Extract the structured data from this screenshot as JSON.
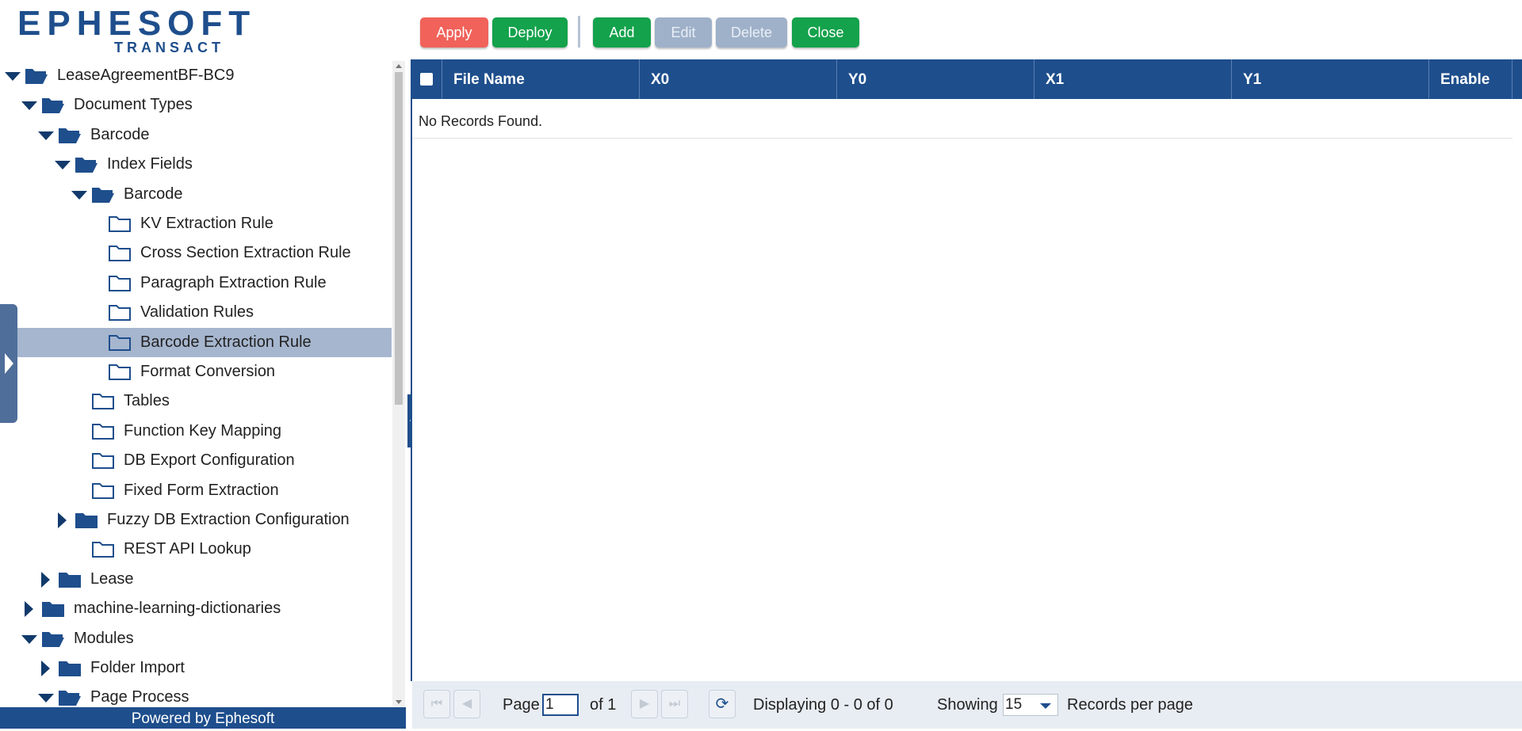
{
  "logo": {
    "word": "EPHESOFT",
    "sub": "TRANSACT"
  },
  "tree": [
    {
      "label": "LeaseAgreementBF-BC9",
      "expander": "down",
      "folder": "open"
    },
    {
      "label": "Document Types",
      "expander": "down",
      "folder": "open"
    },
    {
      "label": "Barcode",
      "expander": "down",
      "folder": "open"
    },
    {
      "label": "Index Fields",
      "expander": "down",
      "folder": "open"
    },
    {
      "label": "Barcode",
      "expander": "down",
      "folder": "open"
    },
    {
      "label": "KV Extraction Rule",
      "expander": "none",
      "folder": "outline"
    },
    {
      "label": "Cross Section Extraction Rule",
      "expander": "none",
      "folder": "outline"
    },
    {
      "label": "Paragraph Extraction Rule",
      "expander": "none",
      "folder": "outline"
    },
    {
      "label": "Validation Rules",
      "expander": "none",
      "folder": "outline"
    },
    {
      "label": "Barcode Extraction Rule",
      "expander": "none",
      "folder": "outline",
      "selected": true
    },
    {
      "label": "Format Conversion",
      "expander": "none",
      "folder": "outline"
    },
    {
      "label": "Tables",
      "expander": "none",
      "folder": "outline"
    },
    {
      "label": "Function Key Mapping",
      "expander": "none",
      "folder": "outline"
    },
    {
      "label": "DB Export Configuration",
      "expander": "none",
      "folder": "outline"
    },
    {
      "label": "Fixed Form Extraction",
      "expander": "none",
      "folder": "outline"
    },
    {
      "label": "Fuzzy DB Extraction Configuration",
      "expander": "right",
      "folder": "closed"
    },
    {
      "label": "REST API Lookup",
      "expander": "none",
      "folder": "outline"
    },
    {
      "label": "Lease",
      "expander": "right",
      "folder": "closed"
    },
    {
      "label": "machine-learning-dictionaries",
      "expander": "right",
      "folder": "closed"
    },
    {
      "label": "Modules",
      "expander": "down",
      "folder": "open"
    },
    {
      "label": "Folder Import",
      "expander": "right",
      "folder": "closed"
    },
    {
      "label": "Page Process",
      "expander": "down",
      "folder": "open"
    }
  ],
  "footer": {
    "powered_by": "Powered by Ephesoft"
  },
  "toolbar": {
    "apply": "Apply",
    "deploy": "Deploy",
    "add": "Add",
    "edit": "Edit",
    "delete": "Delete",
    "close": "Close"
  },
  "grid": {
    "columns": [
      "File Name",
      "X0",
      "Y0",
      "X1",
      "Y1",
      "Enable"
    ],
    "empty_message": "No Records Found."
  },
  "pager": {
    "page_label": "Page",
    "page_value": "1",
    "of_label": "of 1",
    "displaying": "Displaying 0 - 0 of 0",
    "showing_label": "Showing",
    "per_page_value": "15",
    "records_label": "Records per page"
  },
  "colors": {
    "brand": "#1e4e8c",
    "apply": "#f0625a",
    "action": "#14a24c",
    "disabled": "#9fb1c9",
    "selected_row": "#a6b6cf"
  }
}
